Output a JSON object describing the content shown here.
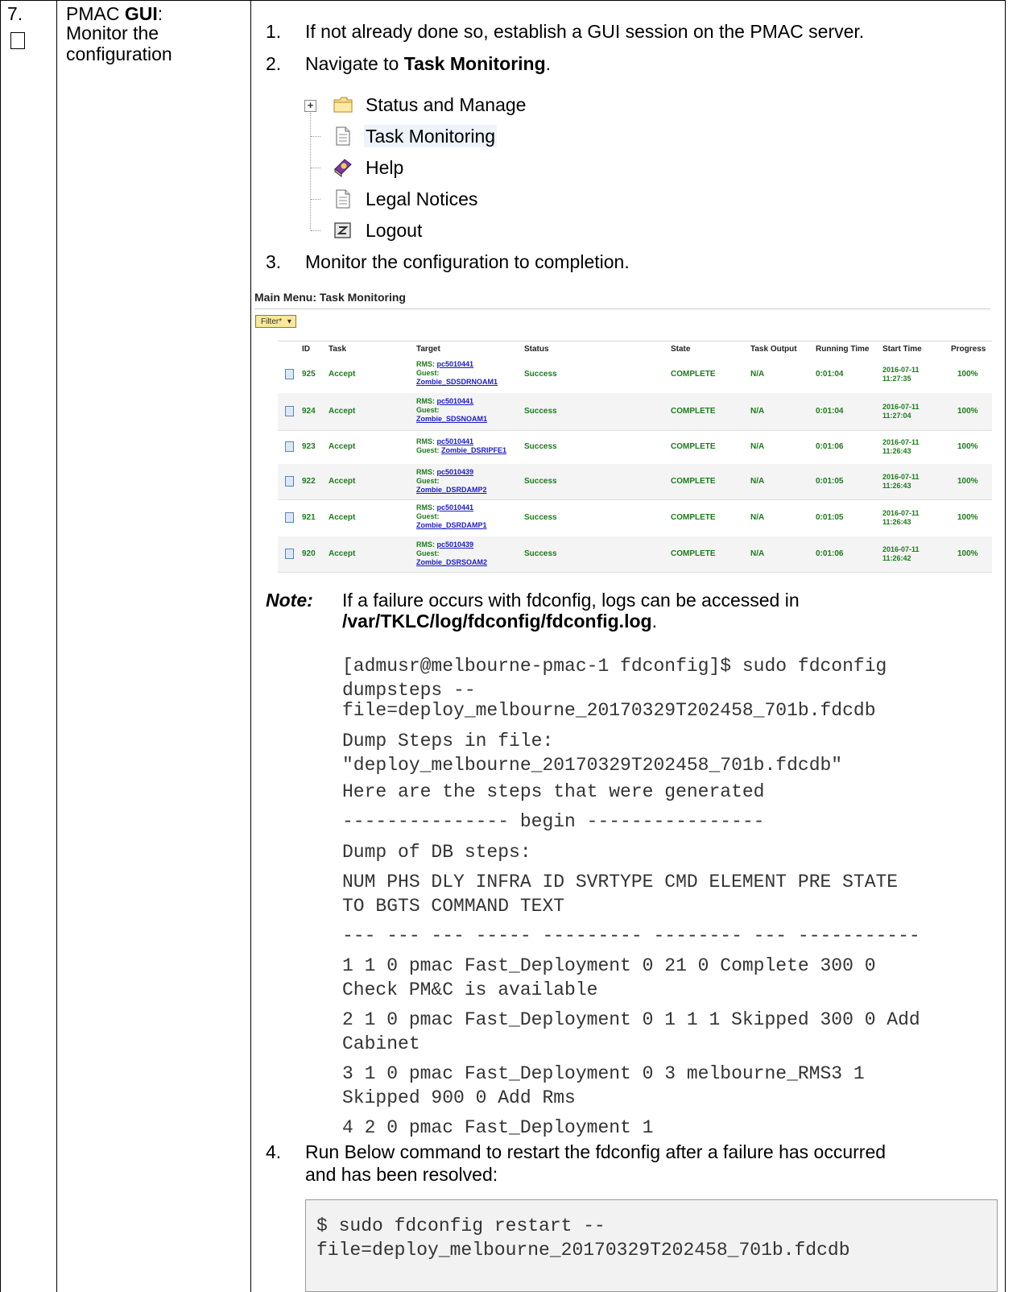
{
  "step": {
    "number": "7.",
    "title_prefix": "PMAC ",
    "title_bold": "GUI",
    "title_suffix": ":",
    "title_line2": "Monitor the",
    "title_line3": "configuration"
  },
  "instructions": {
    "item1_num": "1.",
    "item1_text": "If not already done so, establish a GUI session on the PMAC server.",
    "item2_num": "2.",
    "item2_prefix": "Navigate to ",
    "item2_bold": "Task Monitoring",
    "item2_suffix": ".",
    "item3_num": "3.",
    "item3_text": "Monitor the configuration to completion.",
    "item4_num": "4.",
    "item4_line1": "Run Below command to restart the fdconfig after a failure has occurred",
    "item4_line2": "and has been resolved:"
  },
  "menu_tree": {
    "items": [
      {
        "label": "Status and Manage",
        "icon": "folder-icon"
      },
      {
        "label": "Task Monitoring",
        "icon": "document-icon"
      },
      {
        "label": "Help",
        "icon": "help-book-icon"
      },
      {
        "label": "Legal Notices",
        "icon": "document-icon"
      },
      {
        "label": "Logout",
        "icon": "logout-icon"
      }
    ]
  },
  "task_monitoring": {
    "title": "Main Menu: Task Monitoring",
    "filter_label": "Filter*",
    "columns": [
      "ID",
      "Task",
      "Target",
      "Status",
      "State",
      "Task Output",
      "Running Time",
      "Start Time",
      "Progress"
    ],
    "rows": [
      {
        "id": "925",
        "task": "Accept",
        "rms_label": "RMS:",
        "rms": "pc5010441",
        "guest_label": "Guest:",
        "guest": "Zombie_SDSDRNOAM1",
        "status": "Success",
        "state": "COMPLETE",
        "output": "N/A",
        "running": "0:01:04",
        "start_date": "2016-07-11",
        "start_time": "11:27:35",
        "progress": "100%"
      },
      {
        "id": "924",
        "task": "Accept",
        "rms_label": "RMS:",
        "rms": "pc5010441",
        "guest_label": "Guest:",
        "guest": "Zombie_SDSNOAM1",
        "status": "Success",
        "state": "COMPLETE",
        "output": "N/A",
        "running": "0:01:04",
        "start_date": "2016-07-11",
        "start_time": "11:27:04",
        "progress": "100%"
      },
      {
        "id": "923",
        "task": "Accept",
        "rms_label": "RMS:",
        "rms": "pc5010441",
        "guest_label": "Guest:",
        "guest": "Zombie_DSRIPFE1",
        "status": "Success",
        "state": "COMPLETE",
        "output": "N/A",
        "running": "0:01:06",
        "start_date": "2016-07-11",
        "start_time": "11:26:43",
        "progress": "100%"
      },
      {
        "id": "922",
        "task": "Accept",
        "rms_label": "RMS:",
        "rms": "pc5010439",
        "guest_label": "Guest:",
        "guest": "Zombie_DSRDAMP2",
        "status": "Success",
        "state": "COMPLETE",
        "output": "N/A",
        "running": "0:01:05",
        "start_date": "2016-07-11",
        "start_time": "11:26:43",
        "progress": "100%"
      },
      {
        "id": "921",
        "task": "Accept",
        "rms_label": "RMS:",
        "rms": "pc5010441",
        "guest_label": "Guest:",
        "guest": "Zombie_DSRDAMP1",
        "status": "Success",
        "state": "COMPLETE",
        "output": "N/A",
        "running": "0:01:05",
        "start_date": "2016-07-11",
        "start_time": "11:26:43",
        "progress": "100%"
      },
      {
        "id": "920",
        "task": "Accept",
        "rms_label": "RMS:",
        "rms": "pc5010439",
        "guest_label": "Guest:",
        "guest": "Zombie_DSRSOAM2",
        "status": "Success",
        "state": "COMPLETE",
        "output": "N/A",
        "running": "0:01:06",
        "start_date": "2016-07-11",
        "start_time": "11:26:42",
        "progress": "100%"
      }
    ]
  },
  "note": {
    "label": "Note:",
    "line1": "If a failure occurs with fdconfig, logs can be accessed in",
    "path": "/var/TKLC/log/fdconfig/fdconfig.log",
    "path_suffix": "."
  },
  "console_output": {
    "lines": [
      "[admusr@melbourne-pmac-1 fdconfig]$ sudo fdconfig",
      "dumpsteps --",
      "file=deploy_melbourne_20170329T202458_701b.fdcdb",
      "Dump Steps in file:",
      "\"deploy_melbourne_20170329T202458_701b.fdcdb\"",
      "Here are the steps that were generated",
      "--------------- begin ----------------",
      "Dump of DB steps:",
      "NUM PHS DLY INFRA ID SVRTYPE CMD ELEMENT PRE STATE",
      "TO BGTS COMMAND TEXT",
      "--- --- --- ----- --------- -------- --- -----------",
      "1 1 0 pmac Fast_Deployment 0 21 0 Complete 300 0",
      "Check PM&C is available",
      "2 1 0 pmac Fast_Deployment 0 1 1 1 Skipped 300 0 Add",
      "Cabinet",
      "3 1 0 pmac Fast_Deployment 0 3 melbourne_RMS3 1",
      "Skipped 900 0 Add Rms",
      "4 2 0 pmac Fast_Deployment 1"
    ]
  },
  "restart_command": {
    "line1": "$ sudo fdconfig restart --",
    "line2": "file=deploy_melbourne_20170329T202458_701b.fdcdb"
  }
}
